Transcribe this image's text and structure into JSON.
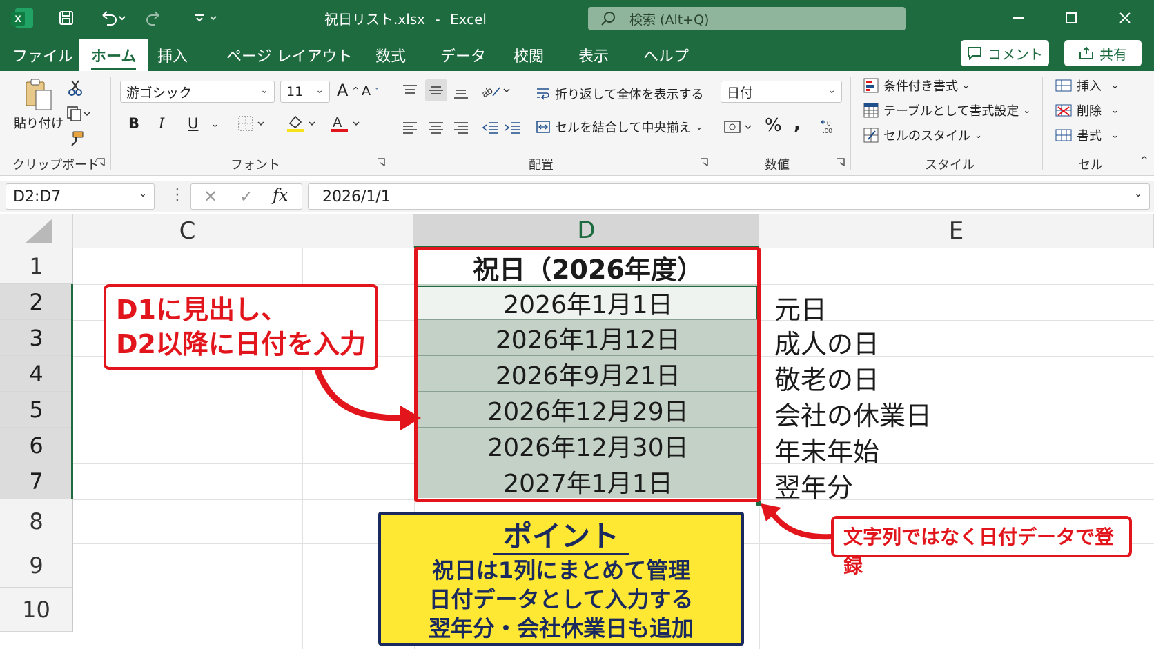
{
  "titlebar": {
    "filename": "祝日リスト.xlsx",
    "separator": "-",
    "app": "Excel",
    "search_placeholder": "検索 (Alt+Q)"
  },
  "menu": {
    "items": [
      "ファイル",
      "ホーム",
      "挿入",
      "ページ レイアウト",
      "数式",
      "データ",
      "校閲",
      "表示",
      "ヘルプ"
    ],
    "active": "ホーム",
    "comment_label": "コメント",
    "share_label": "共有"
  },
  "ribbon": {
    "clipboard": {
      "paste_label": "貼り付け",
      "group_label": "クリップボード"
    },
    "font": {
      "font_name": "游ゴシック",
      "font_size": "11",
      "bold": "B",
      "italic": "I",
      "underline": "U",
      "group_label": "フォント"
    },
    "alignment": {
      "wrap_label": "折り返して全体を表示する",
      "merge_label": "セルを結合して中央揃え",
      "group_label": "配置"
    },
    "number": {
      "format": "日付",
      "percent": "%",
      "comma": ",",
      "group_label": "数値"
    },
    "styles": {
      "conditional": "条件付き書式",
      "table": "テーブルとして書式設定",
      "cell_styles": "セルのスタイル",
      "group_label": "スタイル"
    },
    "cells": {
      "insert": "挿入",
      "delete": "削除",
      "format": "書式",
      "group_label": "セル"
    }
  },
  "formula_bar": {
    "name_box": "D2:D7",
    "fx": "fx",
    "value": "2026/1/1"
  },
  "sheet": {
    "columns": [
      "C",
      "D",
      "E"
    ],
    "rows": [
      "1",
      "2",
      "3",
      "4",
      "5",
      "6",
      "7",
      "8",
      "9",
      "10"
    ],
    "header": "祝日（2026年度）",
    "dates": [
      "2026年1月1日",
      "2026年1月12日",
      "2026年9月21日",
      "2026年12月29日",
      "2026年12月30日",
      "2027年1月1日"
    ],
    "names": [
      "元日",
      "成人の日",
      "敬老の日",
      "会社の休業日",
      "年末年始",
      "翌年分"
    ]
  },
  "annotations": {
    "callout_left_line1": "D1に見出し、",
    "callout_left_line2": "D2以降に日付を入力",
    "callout_right": "文字列ではなく日付データで登録",
    "point_title": "ポイント",
    "point_lines": [
      "祝日は1列にまとめて管理",
      "日付データとして入力する",
      "翌年分・会社休業日も追加"
    ]
  },
  "colors": {
    "excel_green": "#1d6b3f",
    "selection_fill": "#c3d1c7",
    "highlight_red": "#e1151b",
    "point_yellow": "#ffe833",
    "point_navy": "#1a2a5e"
  }
}
